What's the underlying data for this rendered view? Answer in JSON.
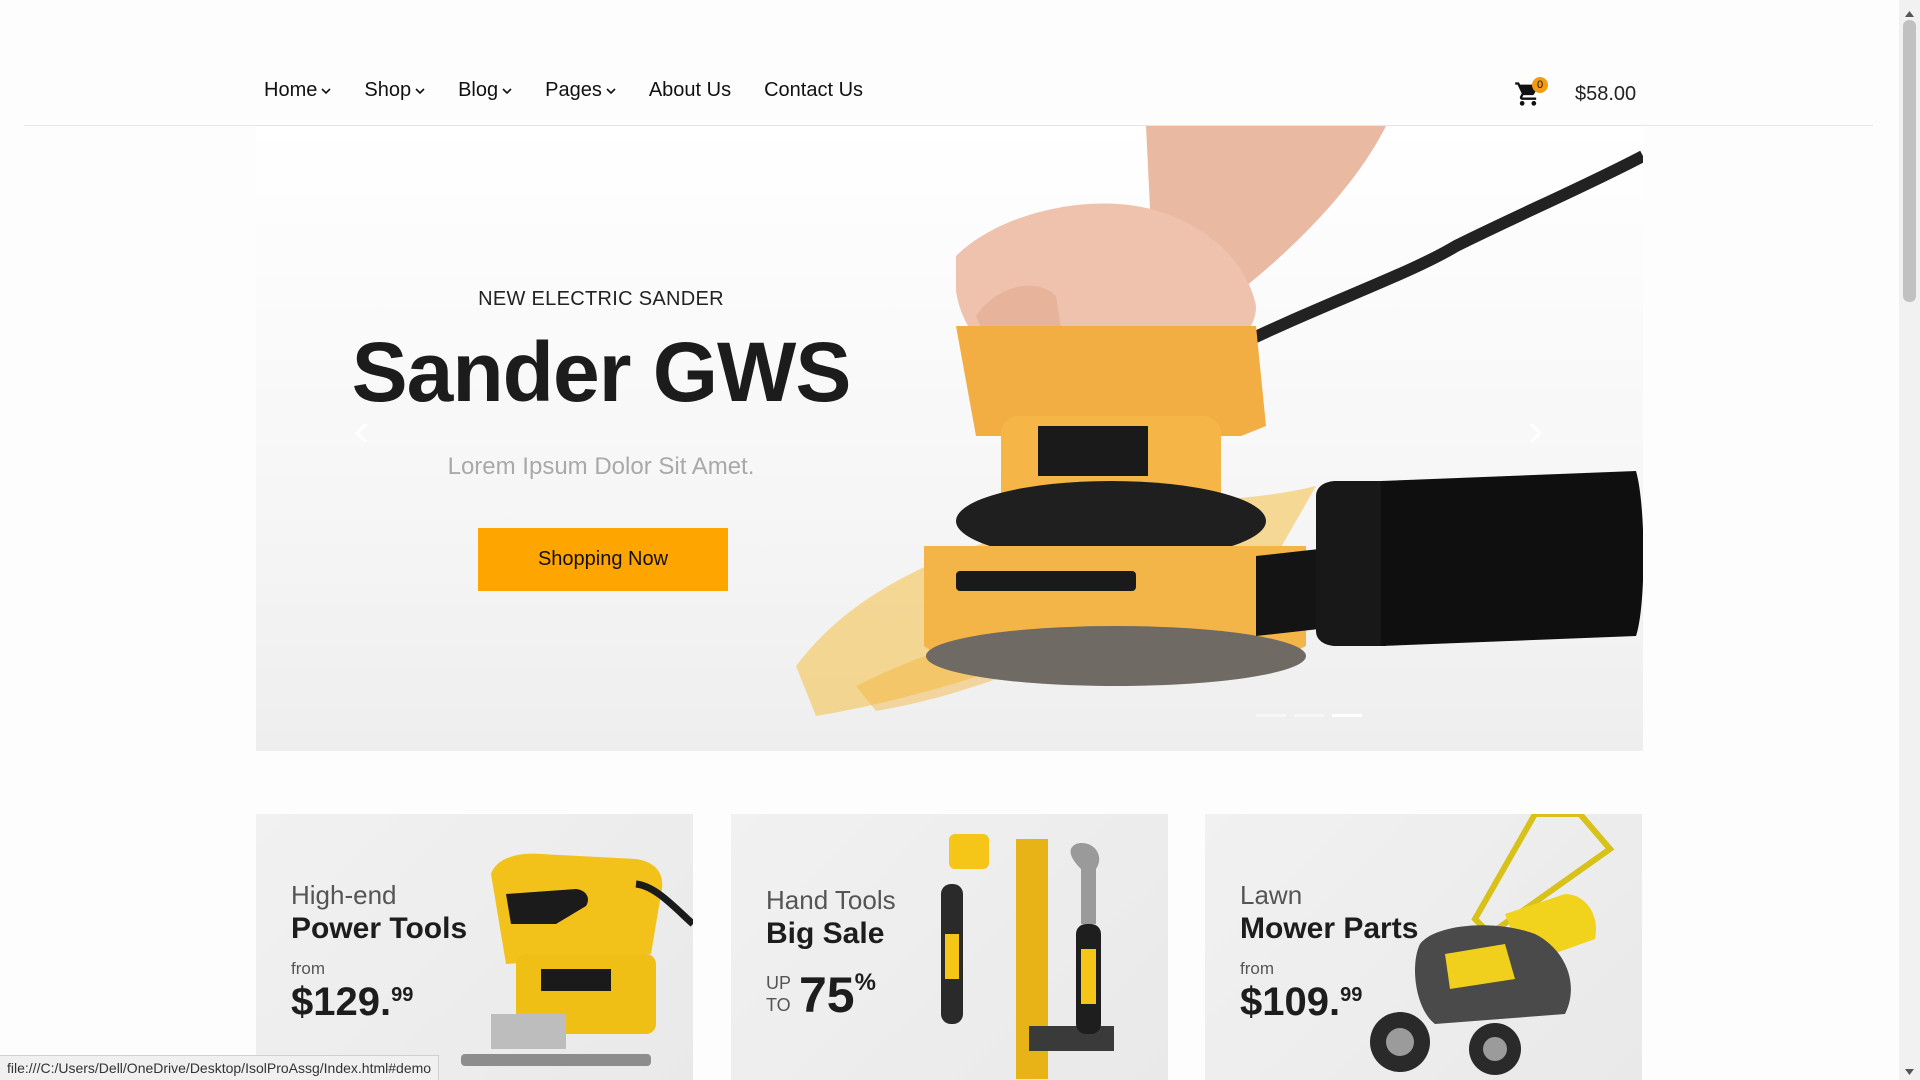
{
  "nav": {
    "items": [
      {
        "label": "Home",
        "has_dropdown": true
      },
      {
        "label": "Shop",
        "has_dropdown": true
      },
      {
        "label": "Blog",
        "has_dropdown": true
      },
      {
        "label": "Pages",
        "has_dropdown": true
      },
      {
        "label": "About Us",
        "has_dropdown": false
      },
      {
        "label": "Contact Us",
        "has_dropdown": false
      }
    ],
    "cart_count": "0",
    "cart_total": "$58.00",
    "cart_icon": "shopping-cart-icon"
  },
  "hero": {
    "kicker": "NEW ELECTRIC SANDER",
    "title": "Sander GWS",
    "subtitle": "Lorem Ipsum Dolor Sit Amet.",
    "button_label": "Shopping Now",
    "slide_count": 3,
    "active_slide": 2
  },
  "cards": [
    {
      "kicker": "High-end",
      "title": "Power Tools",
      "from": "from",
      "price_main": "$129.",
      "price_cents": "99"
    },
    {
      "kicker": "Hand Tools",
      "title": "Big Sale",
      "up": "UP",
      "to": "TO",
      "percent": "75",
      "percent_sign": "%"
    },
    {
      "kicker": "Lawn",
      "title": "Mower Parts",
      "from": "from",
      "price_main": "$109.",
      "price_cents": "99"
    }
  ],
  "status_bar": {
    "url": "file:///C:/Users/Dell/OneDrive/Desktop/IsolProAssg/Index.html#demo"
  },
  "colors": {
    "accent": "#ffa500",
    "badge": "#f39c12",
    "text_dark": "#1c1c1c",
    "subtitle": "#a9a9a9"
  }
}
